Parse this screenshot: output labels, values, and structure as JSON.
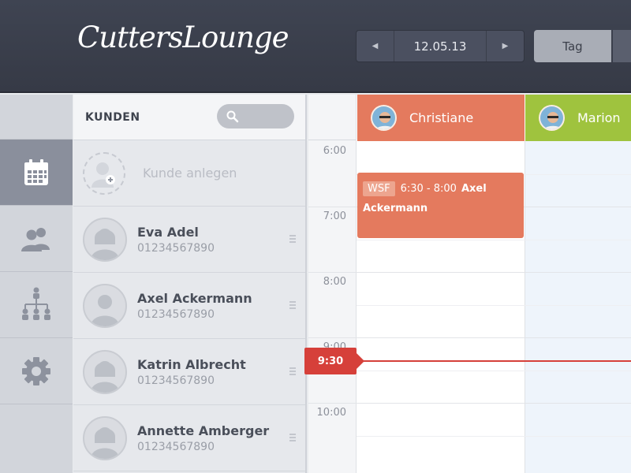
{
  "header": {
    "logo": "CuttersLounge",
    "date": "12.05.13",
    "view_tab": "Tag"
  },
  "nav": {
    "items": [
      {
        "icon": "calendar-icon",
        "active": true
      },
      {
        "icon": "users-icon",
        "active": false
      },
      {
        "icon": "org-chart-icon",
        "active": false
      },
      {
        "icon": "gear-icon",
        "active": false
      }
    ]
  },
  "customers": {
    "title": "KUNDEN",
    "add_label": "Kunde anlegen",
    "list": [
      {
        "name": "Eva Adel",
        "phone": "01234567890",
        "gender": "female"
      },
      {
        "name": "Axel Ackermann",
        "phone": "01234567890",
        "gender": "male"
      },
      {
        "name": "Katrin Albrecht",
        "phone": "01234567890",
        "gender": "female"
      },
      {
        "name": "Annette Amberger",
        "phone": "01234567890",
        "gender": "female"
      }
    ]
  },
  "calendar": {
    "times": [
      "6:00",
      "7:00",
      "8:00",
      "9:00",
      "10:00"
    ],
    "staff": [
      {
        "name": "Christiane",
        "color": "#e47a5e"
      },
      {
        "name": "Marion",
        "color": "#9fc33e"
      }
    ],
    "appointment": {
      "tag": "WSF",
      "time": "6:30 - 8:00",
      "customer_first": "Axel",
      "customer_last": "Ackermann"
    },
    "now": "9:30"
  }
}
